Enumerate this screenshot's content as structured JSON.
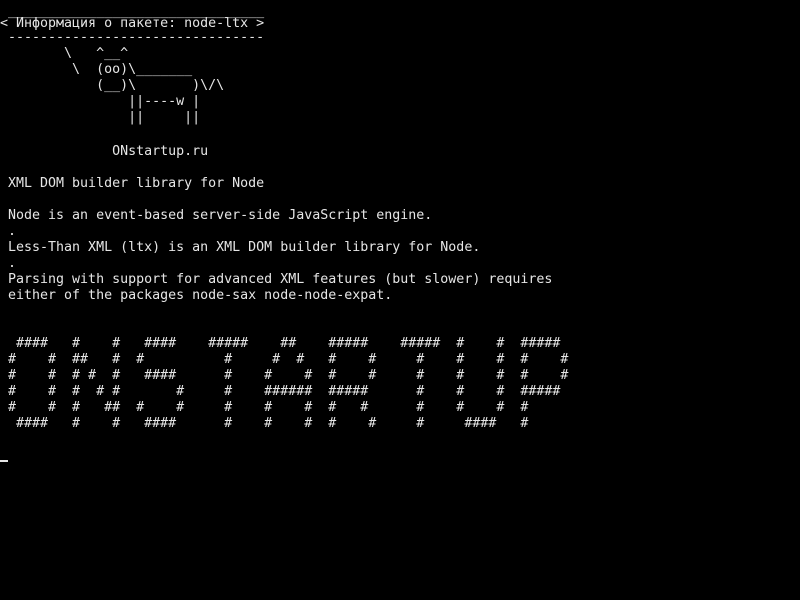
{
  "terminal": {
    "colors": {
      "background": "#000000",
      "foreground": "#e6e6e6"
    },
    "cowsay": [
      " ________________________________",
      "< Информация о пакете: node-ltx >",
      " --------------------------------",
      "        \\   ^__^",
      "         \\  (oo)\\_______",
      "            (__)\\       )\\/\\",
      "                ||----w |",
      "                ||     ||"
    ],
    "site": "              ONstartup.ru",
    "summary": " XML DOM builder library for Node",
    "description": [
      " Node is an event-based server-side JavaScript engine.",
      " .",
      " Less-Than XML (ltx) is an XML DOM builder library for Node.",
      " .",
      " Parsing with support for advanced XML features (but slower) requires",
      " either of the packages node-sax node-node-expat."
    ],
    "banner": [
      "  ####   #    #   ####    #####    ##    #####    #####  #    #  #####",
      " #    #  ##   #  #          #     #  #   #    #     #    #    #  #    #",
      " #    #  # #  #   ####      #    #    #  #    #     #    #    #  #    #",
      " #    #  #  # #       #     #    ######  #####      #    #    #  #####",
      " #    #  #   ##  #    #     #    #    #  #   #      #    #    #  #",
      "  ####   #    #   ####      #    #    #  #    #     #     ####   #"
    ]
  }
}
